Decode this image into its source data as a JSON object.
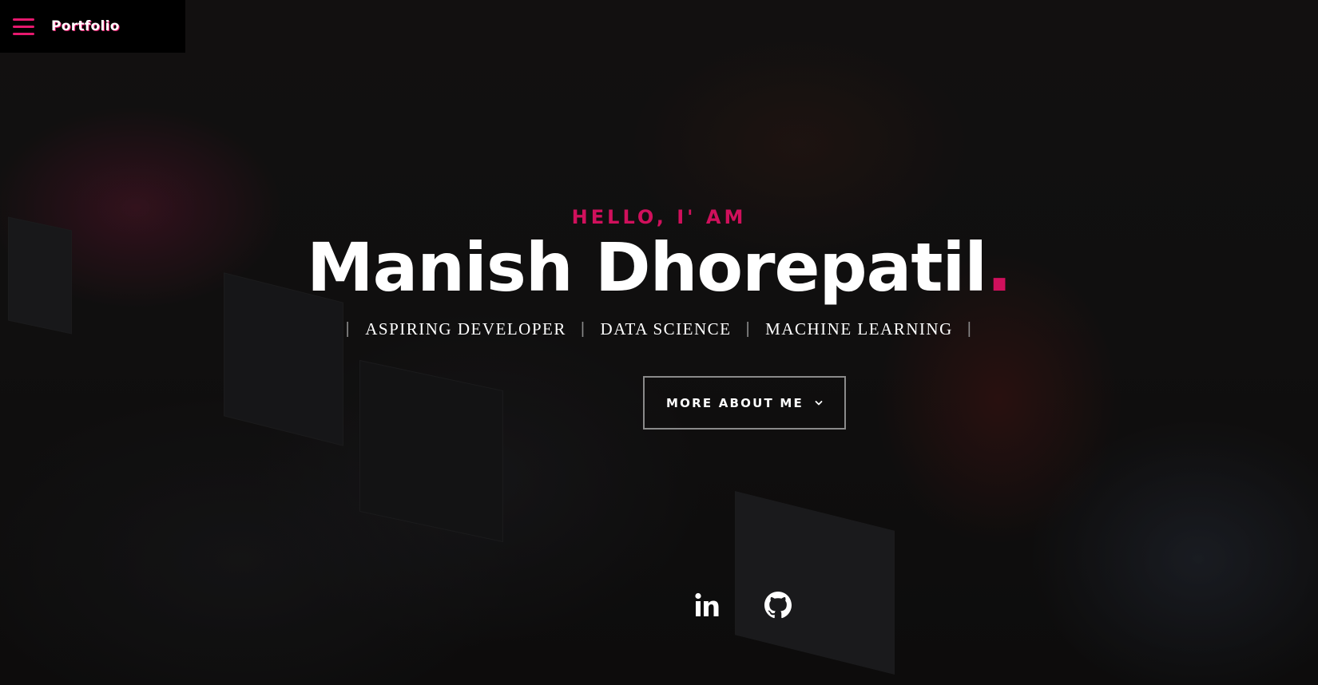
{
  "nav": {
    "brand": "Portfolio",
    "menu_icon": "hamburger-menu-icon"
  },
  "hero": {
    "greeting": "HELLO, I' AM",
    "name": "Manish Dhorepatil",
    "name_suffix": ".",
    "roles": [
      "ASPIRING DEVELOPER",
      "DATA SCIENCE",
      "MACHINE LEARNING"
    ],
    "cta_label": "MORE ABOUT ME",
    "cta_icon": "chevron-down-icon"
  },
  "socials": [
    {
      "icon": "linkedin-icon"
    },
    {
      "icon": "github-icon"
    }
  ],
  "colors": {
    "accent": "#d0105c",
    "nav_bg": "#000000",
    "text": "#ffffff"
  }
}
